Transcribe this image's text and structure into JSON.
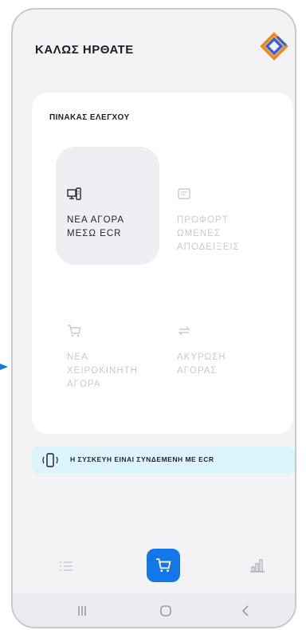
{
  "header": {
    "title": "ΚΑΛΩΣ ΗΡΘΑΤΕ",
    "logo": "brand-diamond-logo"
  },
  "dashboard": {
    "title": "ΠΙΝΑΚΑΣ ΕΛΕΓΧΟΥ",
    "tiles": [
      {
        "label": "ΝΕΑ ΑΓΟΡΑ ΜΕΣΩ ECR",
        "icon": "pos-terminal-icon",
        "active": true
      },
      {
        "label": "ΠΡΟΦΟΡΤ ΩΜΕΝΕΣ ΑΠΟΔΕΙΞΕΙΣ",
        "icon": "receipt-icon",
        "active": false
      },
      {
        "label": "ΝΕΑ ΧΕΙΡΟΚΙΝΗΤΗ ΑΓΟΡΑ",
        "icon": "cart-icon",
        "active": false
      },
      {
        "label": "ΑΚΥΡΩΣΗ ΑΓΟΡΑΣ",
        "icon": "cancel-swap-icon",
        "active": false
      }
    ]
  },
  "status": {
    "text": "Η ΣΥΣΚΕΥΗ ΕΙΝΑΙ ΣΥΝΔΕΜΕΝΗ ΜΕ ECR",
    "icon": "device-connected-icon"
  },
  "bottom_nav": {
    "items": [
      "list-icon",
      "cart-icon",
      "chart-icon"
    ],
    "active_index": 1
  },
  "colors": {
    "accent": "#1277e8",
    "status_bg": "#dcf5fb",
    "background": "#f3f3f6",
    "inactive_text": "#c9c9d6",
    "logo_orange": "#f08a1c",
    "logo_blue": "#3a5fd6"
  }
}
